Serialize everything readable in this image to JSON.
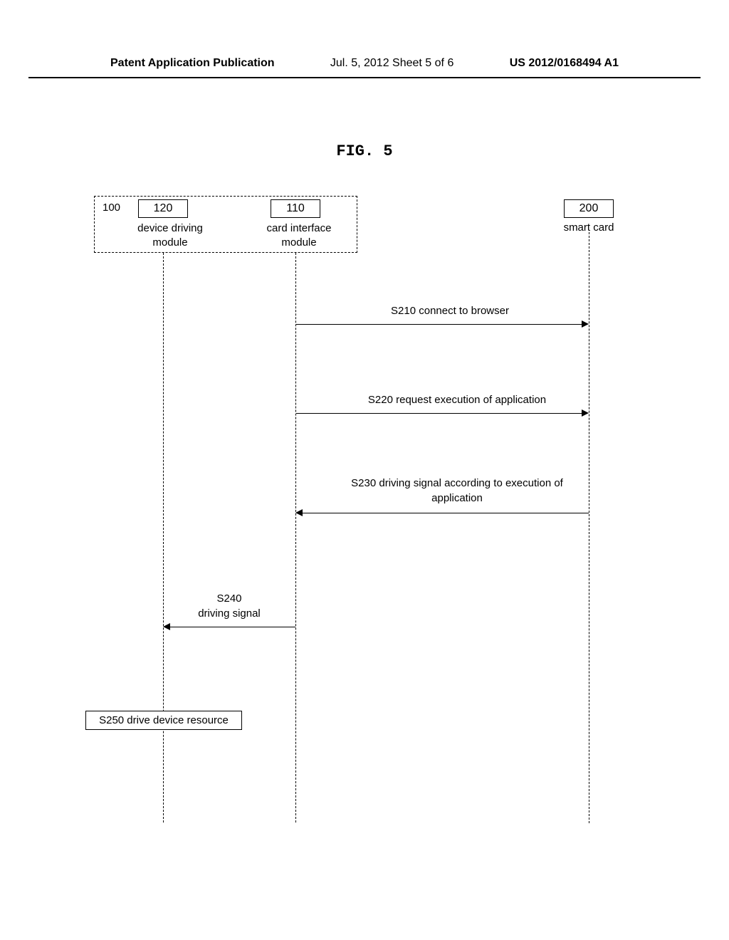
{
  "header": {
    "left": "Patent Application Publication",
    "center": "Jul. 5, 2012   Sheet 5 of 6",
    "right": "US 2012/0168494 A1"
  },
  "figure_title": "FIG. 5",
  "components": {
    "num_100": "100",
    "box_120": "120",
    "label_120": "device driving module",
    "box_110": "110",
    "label_110": "card interface module",
    "box_200": "200",
    "label_200": "smart card"
  },
  "messages": {
    "s210": "S210 connect to browser",
    "s220": "S220 request execution of application",
    "s230": "S230 driving signal according to execution of application",
    "s240_label": "S240",
    "s240_text": "driving signal",
    "s250": "S250 drive device resource"
  }
}
